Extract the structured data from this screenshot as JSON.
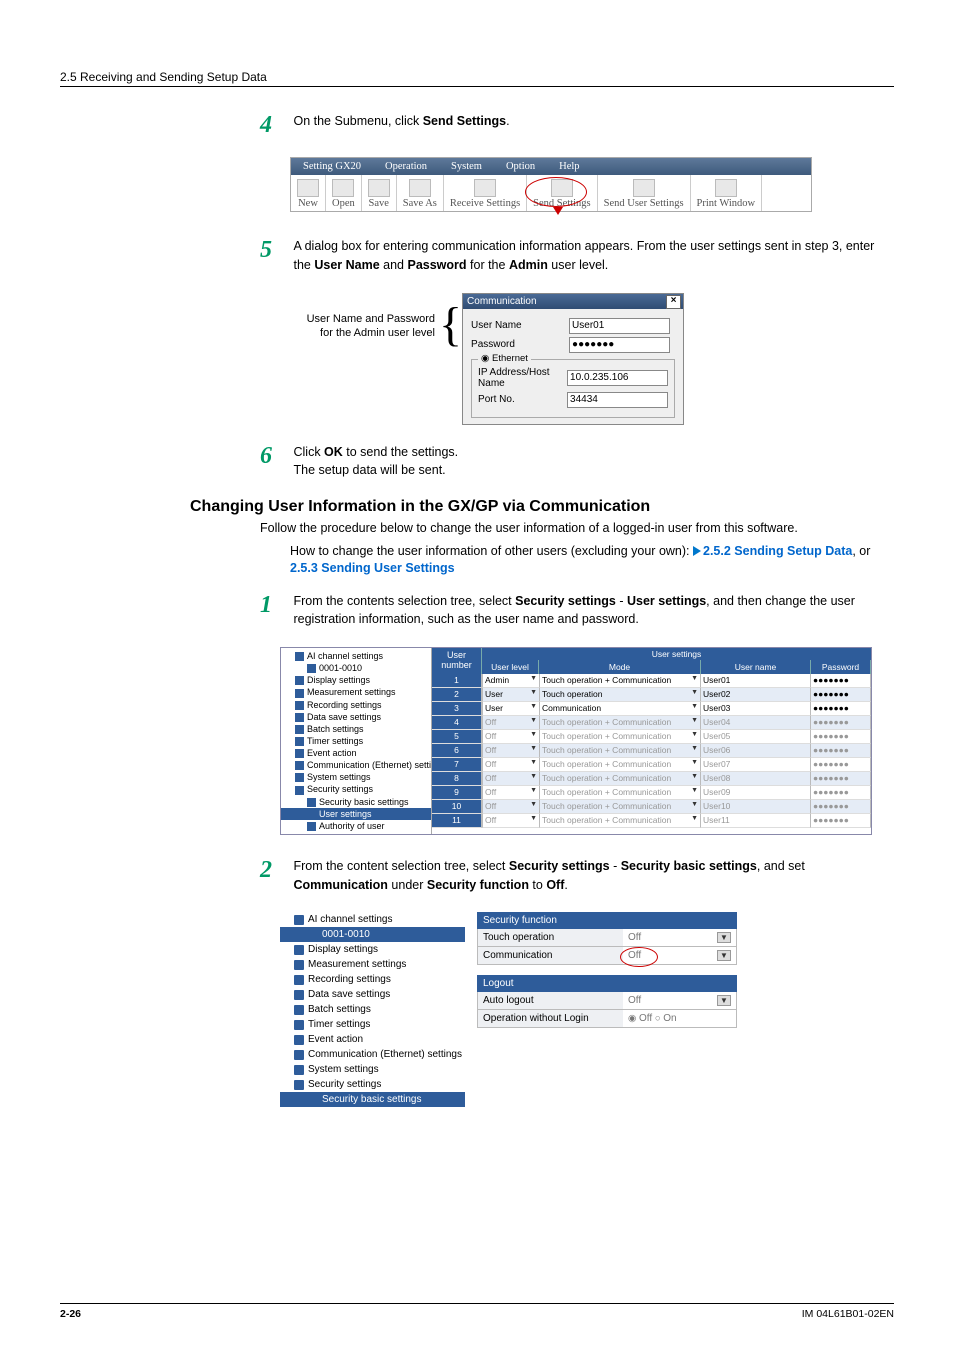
{
  "header": {
    "section_label": "2.5  Receiving and Sending Setup Data"
  },
  "step4": {
    "num": "4",
    "text_before": "On the Submenu, click ",
    "text_bold": "Send Settings",
    "text_after": "."
  },
  "toolbar": {
    "menu": [
      "Setting GX20",
      "Operation",
      "System",
      "Option",
      "Help"
    ],
    "buttons": [
      "New",
      "Open",
      "Save",
      "Save As",
      "Receive Settings",
      "Send Settings",
      "Send User Settings",
      "Print Window"
    ]
  },
  "step5": {
    "num": "5",
    "line1": "A dialog box for entering communication information appears. From the user settings sent in step 3, enter the ",
    "b1": "User Name",
    "mid": " and ",
    "b2": "Password",
    "line1b": " for the ",
    "b3": "Admin",
    "line1c": " user level.",
    "callout1": "User Name and Password",
    "callout2": "for the Admin user level"
  },
  "comm_dialog": {
    "title": "Communication",
    "username_lbl": "User Name",
    "username_val": "User01",
    "password_lbl": "Password",
    "password_val": "●●●●●●●",
    "frame": "Ethernet",
    "ip_lbl": "IP Address/Host Name",
    "ip_val": "10.0.235.106",
    "port_lbl": "Port No.",
    "port_val": "34434"
  },
  "step6": {
    "num": "6",
    "line_before": "Click ",
    "b": "OK",
    "line_after": " to send the settings.",
    "sub": "The setup data will be sent."
  },
  "section_h": "Changing User Information in the GX/GP via Communication",
  "section_p": "Follow the procedure below to change the user information of a logged-in user from this software.",
  "section_link_intro": "How to change the user information of other users (excluding your own): ",
  "section_link1": "2.5.2 Sending Setup Data",
  "section_link_mid": ", or ",
  "section_link2": "2.5.3 Sending User Settings",
  "step1": {
    "num": "1",
    "t1": "From the contents selection tree, select ",
    "b1": "Security settings",
    "t2": " - ",
    "b2": "User settings",
    "t3": ", and then change the user registration information, such as the user name and password."
  },
  "tree1": [
    "AI channel settings",
    "0001-0010",
    "Display settings",
    "Measurement settings",
    "Recording settings",
    "Data save settings",
    "Batch settings",
    "Timer settings",
    "Event action",
    "Communication (Ethernet) settings",
    "System settings",
    "Security settings",
    "Security basic settings",
    "User settings",
    "Authority of user"
  ],
  "user_table": {
    "top_label": "User settings",
    "cols": [
      "User number",
      "User level",
      "Mode",
      "User name",
      "Password"
    ],
    "rows": [
      {
        "n": "1",
        "lvl": "Admin",
        "mode": "Touch operation + Communication",
        "usr": "User01",
        "pwd": "●●●●●●●",
        "dis": false
      },
      {
        "n": "2",
        "lvl": "User",
        "mode": "Touch operation",
        "usr": "User02",
        "pwd": "●●●●●●●",
        "dis": false
      },
      {
        "n": "3",
        "lvl": "User",
        "mode": "Communication",
        "usr": "User03",
        "pwd": "●●●●●●●",
        "dis": false
      },
      {
        "n": "4",
        "lvl": "Off",
        "mode": "Touch operation + Communication",
        "usr": "User04",
        "pwd": "●●●●●●●",
        "dis": true
      },
      {
        "n": "5",
        "lvl": "Off",
        "mode": "Touch operation + Communication",
        "usr": "User05",
        "pwd": "●●●●●●●",
        "dis": true
      },
      {
        "n": "6",
        "lvl": "Off",
        "mode": "Touch operation + Communication",
        "usr": "User06",
        "pwd": "●●●●●●●",
        "dis": true
      },
      {
        "n": "7",
        "lvl": "Off",
        "mode": "Touch operation + Communication",
        "usr": "User07",
        "pwd": "●●●●●●●",
        "dis": true
      },
      {
        "n": "8",
        "lvl": "Off",
        "mode": "Touch operation + Communication",
        "usr": "User08",
        "pwd": "●●●●●●●",
        "dis": true
      },
      {
        "n": "9",
        "lvl": "Off",
        "mode": "Touch operation + Communication",
        "usr": "User09",
        "pwd": "●●●●●●●",
        "dis": true
      },
      {
        "n": "10",
        "lvl": "Off",
        "mode": "Touch operation + Communication",
        "usr": "User10",
        "pwd": "●●●●●●●",
        "dis": true
      },
      {
        "n": "11",
        "lvl": "Off",
        "mode": "Touch operation + Communication",
        "usr": "User11",
        "pwd": "●●●●●●●",
        "dis": true
      }
    ]
  },
  "step2": {
    "num": "2",
    "t1": "From the content selection tree, select ",
    "b1": "Security settings",
    "t2": " - ",
    "b2": "Security basic settings",
    "t3": ", and set ",
    "b3": "Communication",
    "t4": " under ",
    "b4": "Security function",
    "t5": " to ",
    "b5": "Off",
    "t6": "."
  },
  "tree2": [
    "AI channel settings",
    "0001-0010",
    "Display settings",
    "Measurement settings",
    "Recording settings",
    "Data save settings",
    "Batch settings",
    "Timer settings",
    "Event action",
    "Communication (Ethernet) settings",
    "System settings",
    "Security settings",
    "Security basic settings"
  ],
  "panel2": {
    "hdr1": "Security function",
    "touch_lbl": "Touch operation",
    "touch_val": "Off",
    "comm_lbl": "Communication",
    "comm_val": "Off",
    "hdr2": "Logout",
    "auto_lbl": "Auto logout",
    "auto_val": "Off",
    "op_lbl": "Operation without Login",
    "op_off": "Off",
    "op_on": "On"
  },
  "footer": {
    "page": "2-26",
    "doc": "IM 04L61B01-02EN"
  }
}
